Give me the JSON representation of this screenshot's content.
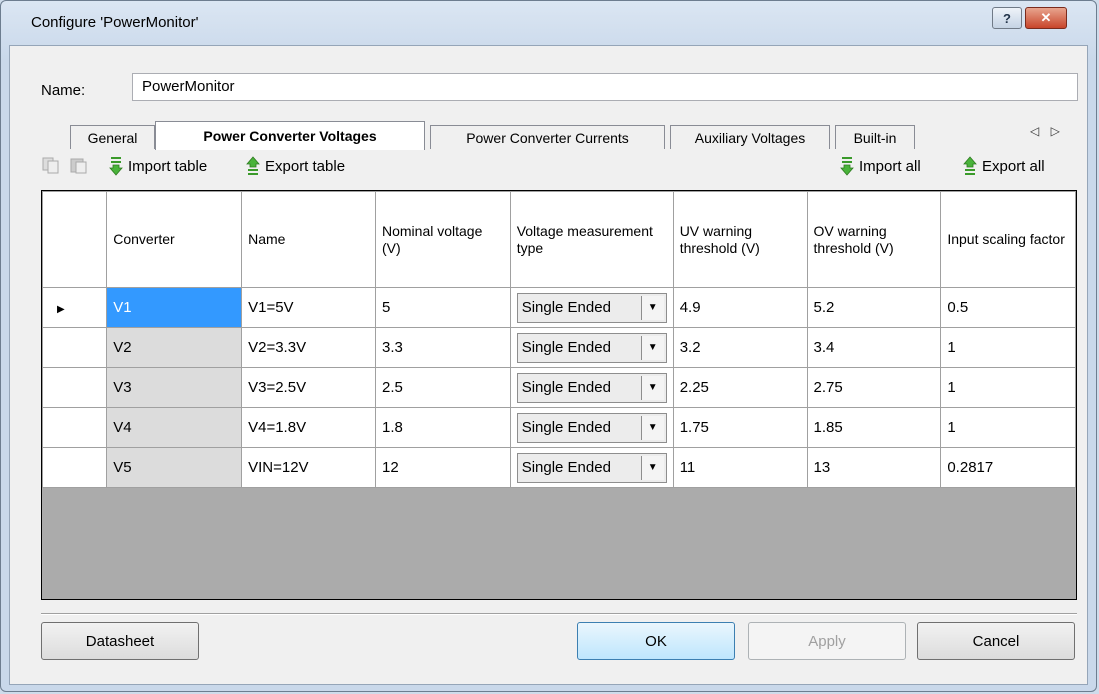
{
  "window": {
    "title": "Configure 'PowerMonitor'",
    "help_label": "?",
    "close_label": "✕"
  },
  "name_field": {
    "label": "Name:",
    "value": "PowerMonitor"
  },
  "tabs": [
    {
      "label": "General"
    },
    {
      "label": "Power Converter Voltages"
    },
    {
      "label": "Power Converter Currents"
    },
    {
      "label": "Auxiliary Voltages"
    },
    {
      "label": "Built-in"
    }
  ],
  "tab_scroll": "◁ ▷",
  "toolbar": {
    "import_table": "Import table",
    "export_table": "Export table",
    "import_all": "Import all",
    "export_all": "Export all"
  },
  "grid": {
    "headers": {
      "converter": "Converter",
      "name": "Name",
      "nominal": "Nominal voltage (V)",
      "meas_type": "Voltage measurement type",
      "uv": "UV warning threshold (V)",
      "ov": "OV warning threshold (V)",
      "scaling": "Input scaling factor"
    },
    "rows": [
      {
        "converter": "V1",
        "name": "V1=5V",
        "nominal": "5",
        "meas_type": "Single Ended",
        "uv": "4.9",
        "ov": "5.2",
        "scaling": "0.5"
      },
      {
        "converter": "V2",
        "name": "V2=3.3V",
        "nominal": "3.3",
        "meas_type": "Single Ended",
        "uv": "3.2",
        "ov": "3.4",
        "scaling": "1"
      },
      {
        "converter": "V3",
        "name": "V3=2.5V",
        "nominal": "2.5",
        "meas_type": "Single Ended",
        "uv": "2.25",
        "ov": "2.75",
        "scaling": "1"
      },
      {
        "converter": "V4",
        "name": "V4=1.8V",
        "nominal": "1.8",
        "meas_type": "Single Ended",
        "uv": "1.75",
        "ov": "1.85",
        "scaling": "1"
      },
      {
        "converter": "V5",
        "name": "VIN=12V",
        "nominal": "12",
        "meas_type": "Single Ended",
        "uv": "11",
        "ov": "13",
        "scaling": "0.2817"
      }
    ]
  },
  "buttons": {
    "datasheet": "Datasheet",
    "ok": "OK",
    "apply": "Apply",
    "cancel": "Cancel"
  },
  "colors": {
    "selection": "#3399ff",
    "ok_border": "#3c7fb1",
    "close_red": "#c8452b"
  }
}
